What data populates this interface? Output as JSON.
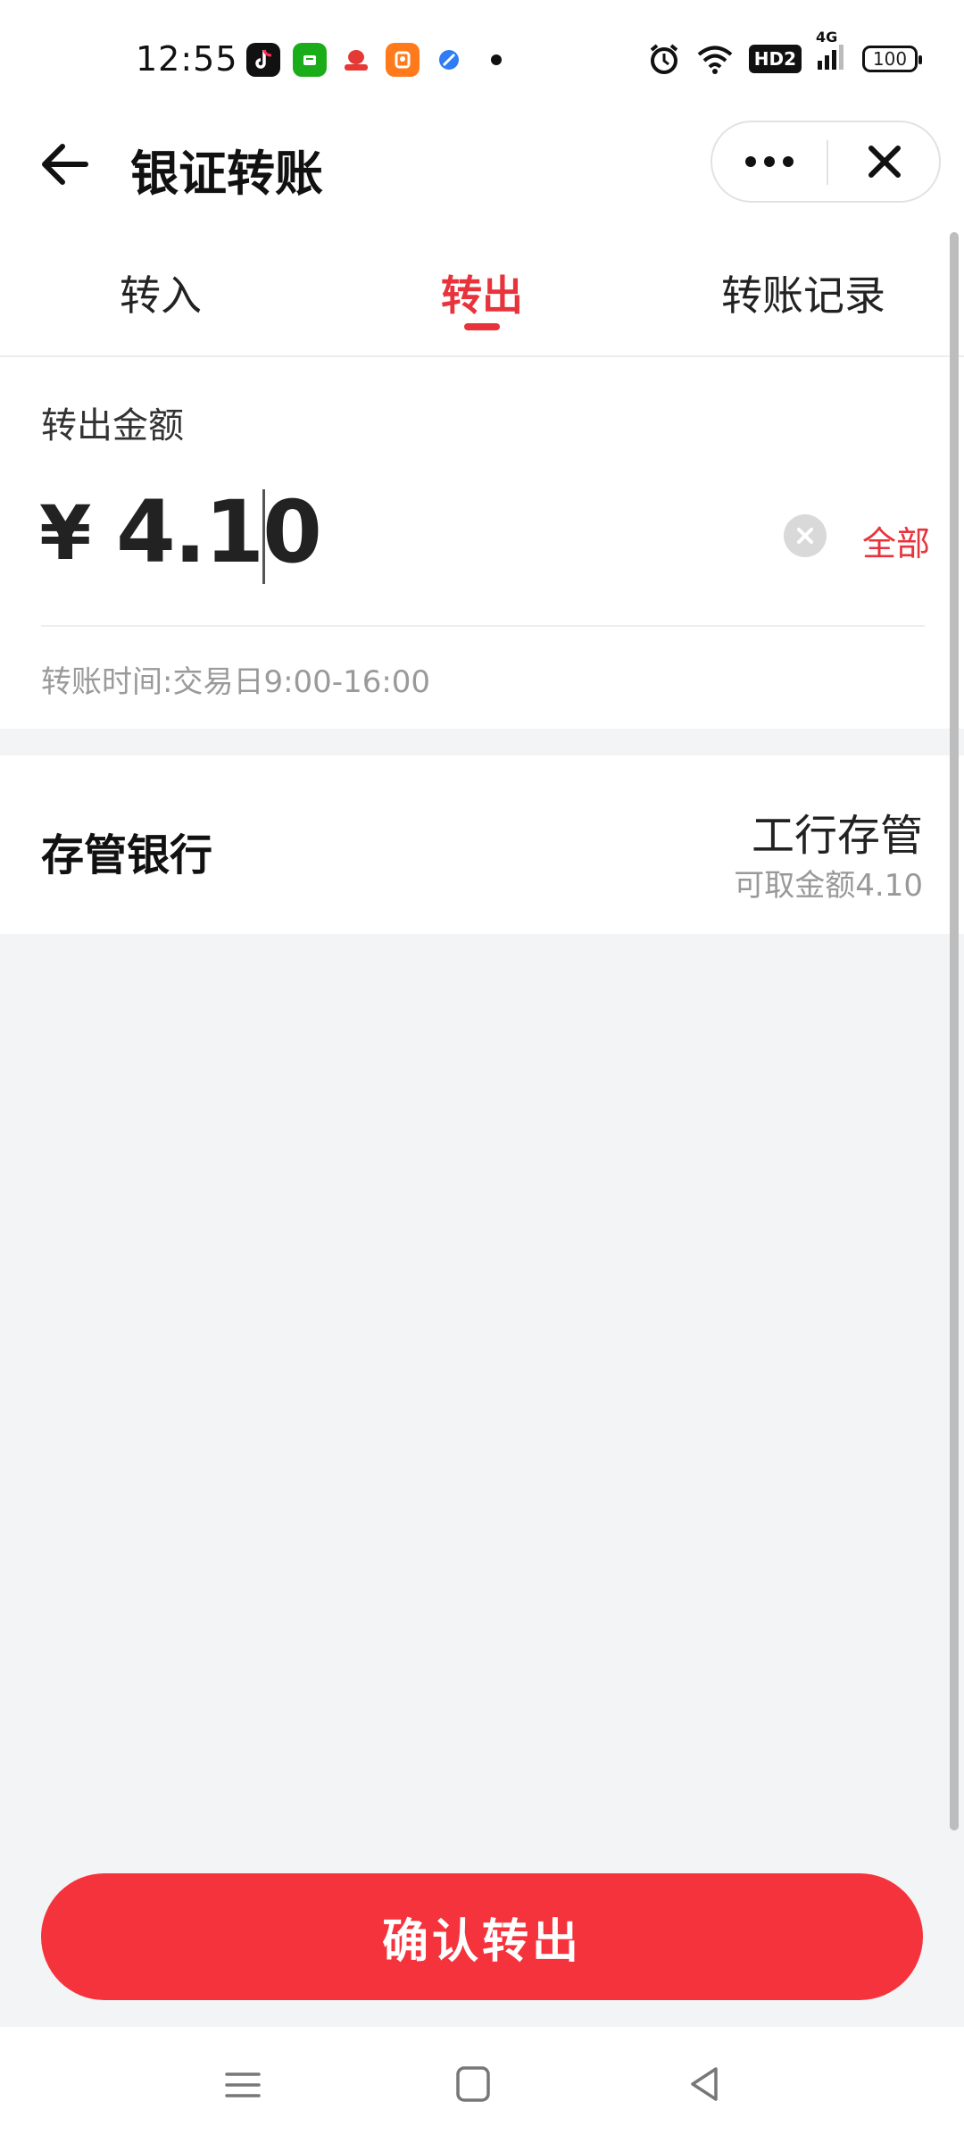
{
  "status_bar": {
    "time": "12:55",
    "app_icons": [
      "tiktok-icon",
      "wechat-pay-icon",
      "red-envelope-app-icon",
      "shopping-app-icon",
      "browser-app-icon"
    ],
    "hd_label": "HD2",
    "network_label": "4G",
    "battery": "100"
  },
  "header": {
    "title": "银证转账"
  },
  "tabs": [
    {
      "label": "转入",
      "active": false
    },
    {
      "label": "转出",
      "active": true
    },
    {
      "label": "转账记录",
      "active": false
    }
  ],
  "amount": {
    "label": "转出金额",
    "currency_symbol": "¥",
    "value": "4.10",
    "all_label": "全部",
    "transfer_time_note": "转账时间:交易日9:00-16:00"
  },
  "custodian": {
    "label": "存管银行",
    "bank_name": "工行存管",
    "available": "可取金额4.10"
  },
  "confirm_button": {
    "label": "确认转出"
  },
  "colors": {
    "accent": "#e8333c",
    "button": "#f5333c",
    "background": "#f3f4f6"
  }
}
